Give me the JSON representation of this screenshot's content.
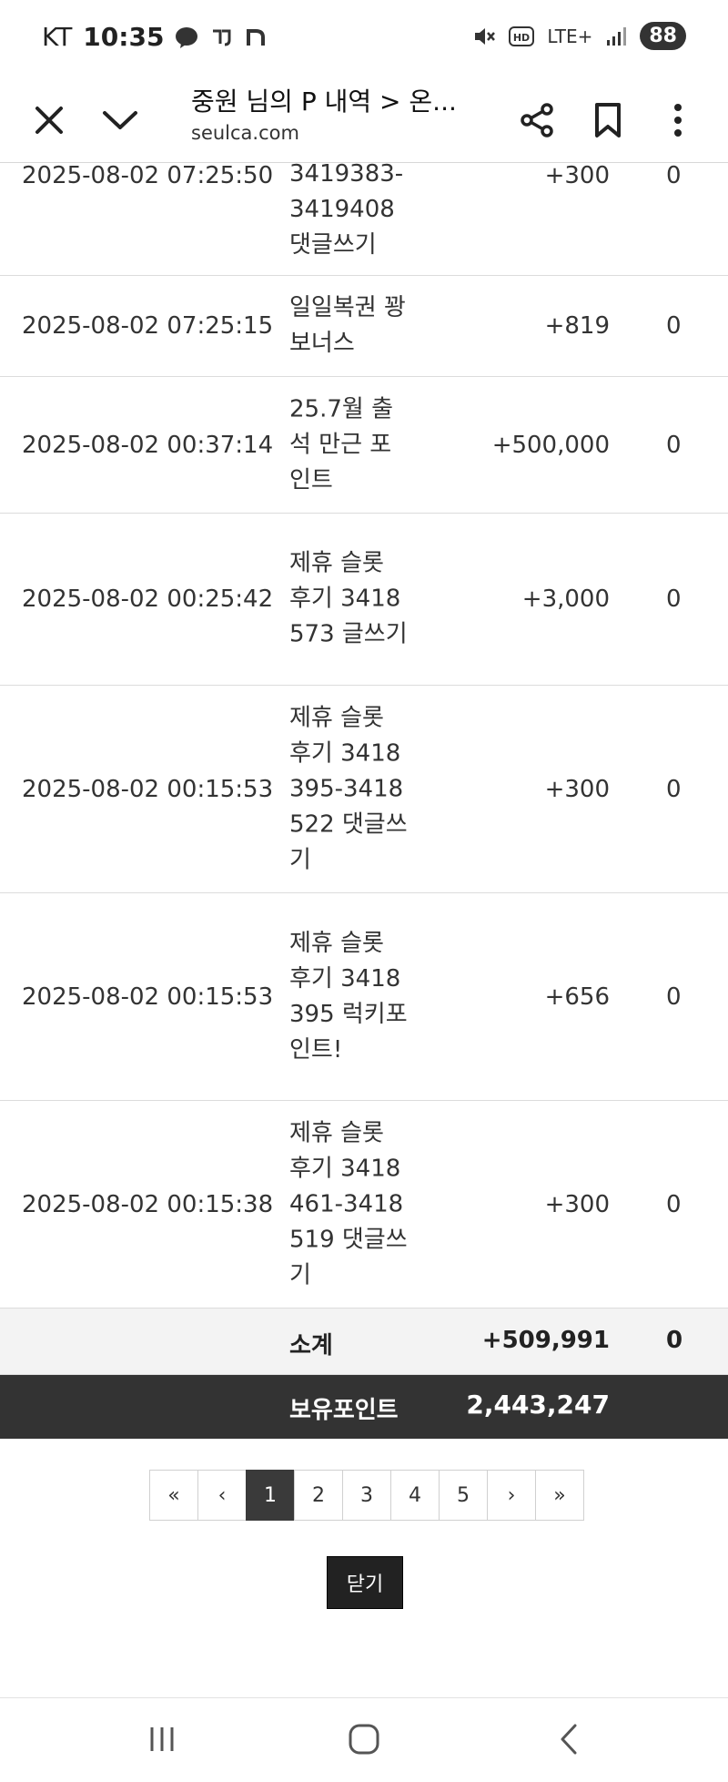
{
  "status_bar": {
    "carrier": "KT",
    "time": "10:35",
    "battery": "88",
    "network": "LTE+"
  },
  "browser": {
    "title": "중원 님의 P 내역 > 온...",
    "domain": "seulca.com"
  },
  "table": {
    "rows": [
      {
        "date": "2025-08-02 07:25:50",
        "desc": "3419383-3419408 댓글쓰기",
        "amount": "+300",
        "used": "0"
      },
      {
        "date": "2025-08-02 07:25:15",
        "desc": "일일복권 꽝 보너스",
        "amount": "+819",
        "used": "0"
      },
      {
        "date": "2025-08-02 00:37:14",
        "desc": "25.7월 출석 만근 포인트",
        "amount": "+500,000",
        "used": "0"
      },
      {
        "date": "2025-08-02 00:25:42",
        "desc": "제휴 슬롯 후기 3418573 글쓰기",
        "amount": "+3,000",
        "used": "0"
      },
      {
        "date": "2025-08-02 00:15:53",
        "desc": "제휴 슬롯 후기 3418395-3418522 댓글쓰기",
        "amount": "+300",
        "used": "0"
      },
      {
        "date": "2025-08-02 00:15:53",
        "desc": "제휴 슬롯 후기 3418395 럭키포인트!",
        "amount": "+656",
        "used": "0"
      },
      {
        "date": "2025-08-02 00:15:38",
        "desc": "제휴 슬롯 후기 3418461-3418519 댓글쓰기",
        "amount": "+300",
        "used": "0"
      }
    ],
    "subtotal": {
      "label": "소계",
      "amount": "+509,991",
      "used": "0"
    },
    "holding": {
      "label": "보유포인트",
      "value": "2,443,247"
    }
  },
  "pagination": {
    "first": "«",
    "prev": "‹",
    "pages": [
      "1",
      "2",
      "3",
      "4",
      "5"
    ],
    "current": "1",
    "next": "›",
    "last": "»"
  },
  "close_button": "닫기"
}
